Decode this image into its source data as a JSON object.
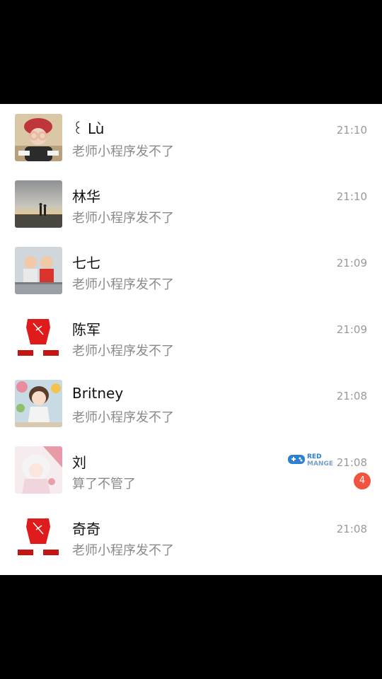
{
  "chats": [
    {
      "name": "꒰ Lù",
      "preview": "老师小程序发不了",
      "time": "21:10"
    },
    {
      "name": "林华",
      "preview": "老师小程序发不了",
      "time": "21:10"
    },
    {
      "name": "七七",
      "preview": "老师小程序发不了",
      "time": "21:09"
    },
    {
      "name": "陈军",
      "preview": "老师小程序发不了",
      "time": "21:09"
    },
    {
      "name": "Britney",
      "preview": "老师小程序发不了",
      "time": "21:08"
    },
    {
      "name": "刘",
      "preview": "算了不管了",
      "time": "21:08",
      "unread": "4"
    },
    {
      "name": "奇奇",
      "preview": "老师小程序发不了",
      "time": "21:08"
    }
  ],
  "watermark": {
    "text": "RED MANGE",
    "icon": "gamepad-icon"
  },
  "colors": {
    "badge": "#f25341",
    "time": "#999999",
    "preview": "#8a8a8a"
  }
}
